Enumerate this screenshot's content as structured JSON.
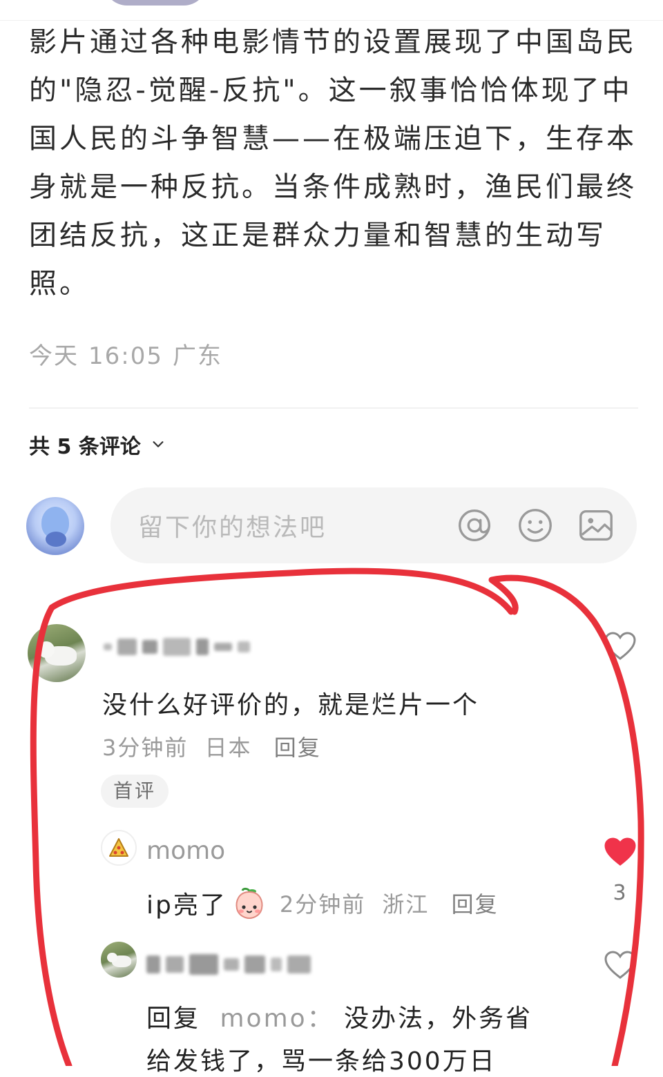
{
  "post": {
    "body": "影片通过各种电影情节的设置展现了中国岛民的\"隐忍-觉醒-反抗\"。这一叙事恰恰体现了中国人民的斗争智慧——在极端压迫下，生存本身就是一种反抗。当条件成熟时，渔民们最终团结反抗，这正是群众力量和智慧的生动写照。",
    "date": "今天",
    "time": "16:05",
    "location": "广东"
  },
  "comments_header": {
    "label": "共 5 条评论"
  },
  "input": {
    "placeholder": "留下你的想法吧"
  },
  "comments": [
    {
      "text": "没什么好评价的，就是烂片一个",
      "time": "3分钟前",
      "location": "日本",
      "reply_label": "回复",
      "badge": "首评",
      "liked": false,
      "replies": [
        {
          "author": "momo",
          "text": "ip亮了",
          "emoji": "peach-face",
          "time": "2分钟前",
          "location": "浙江",
          "reply_label": "回复",
          "liked": true,
          "likes": "3"
        },
        {
          "reply_prefix": "回复",
          "reply_to": "momo：",
          "text_line1": "没办法，外务省",
          "text_line2": "给发钱了，骂一条给300万日",
          "liked": false
        }
      ]
    }
  ],
  "colors": {
    "annotation_red": "#e8313b",
    "liked_heart": "#f0334a",
    "muted": "#9a9a9a"
  },
  "icons": [
    "at-icon",
    "emoji-icon",
    "image-icon",
    "heart-icon",
    "chevron-down-icon"
  ]
}
